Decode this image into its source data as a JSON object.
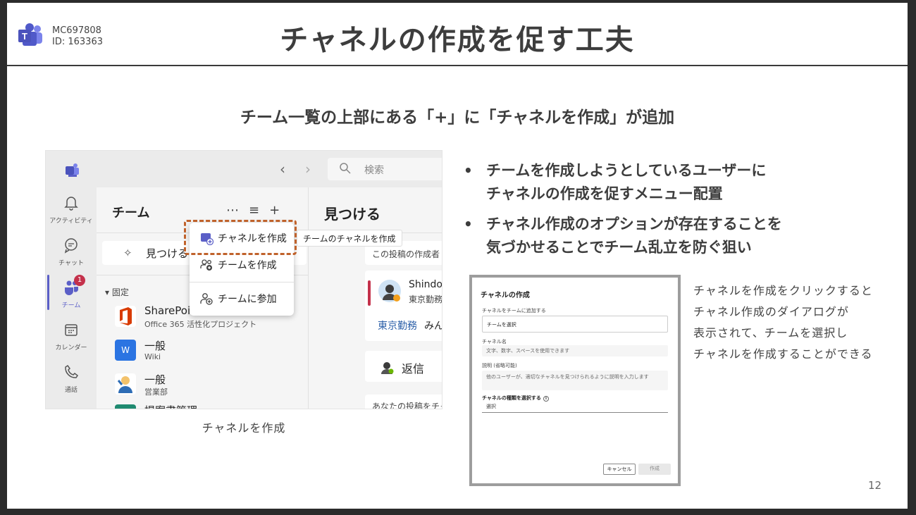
{
  "header": {
    "mc_code": "MC697808",
    "id_label": "ID: 163363",
    "title": "チャネルの作成を促す工夫"
  },
  "subtitle": "チーム一覧の上部にある「+」に「チャネルを作成」が追加",
  "teams_window": {
    "search_placeholder": "検索",
    "nav_back": "‹",
    "nav_forward": "›",
    "rail": [
      {
        "label": "アクティビティ",
        "icon": "bell-icon"
      },
      {
        "label": "チャット",
        "icon": "chat-icon"
      },
      {
        "label": "チーム",
        "icon": "teams-icon",
        "badge": "1"
      },
      {
        "label": "カレンダー",
        "icon": "calendar-icon"
      },
      {
        "label": "通話",
        "icon": "phone-icon"
      }
    ],
    "panel_title": "チーム",
    "panel_icons": {
      "more": "⋯",
      "filter": "≡",
      "add": "+"
    },
    "discover_label": "見つける",
    "pinned_label": "▾ 固定",
    "teams": [
      {
        "name": "SharePoint",
        "sub": "Office 365 活性化プロジェクト",
        "color": "#d83b01"
      },
      {
        "name": "一般",
        "sub": "Wiki",
        "color": "#2b74e2"
      },
      {
        "name": "一般",
        "sub": "営業部",
        "color": "#f3c26b"
      },
      {
        "name": "提案書管理",
        "sub": "",
        "color": "#1f8a70"
      }
    ],
    "main_title": "見つける",
    "card1_text": "この投稿の作成者",
    "card2_name": "Shindo",
    "card2_sub": "東京勤務",
    "card2_link": "東京勤務",
    "card2_link_rest": "みん",
    "reply_label": "返信",
    "card3_text": "あなたの投稿をチャ",
    "menu": [
      {
        "label": "チャネルを作成",
        "icon": "channel-add-icon"
      },
      {
        "label": "チームを作成",
        "icon": "team-add-icon"
      },
      {
        "label": "チームに参加",
        "icon": "join-team-icon"
      }
    ],
    "tooltip": "チームのチャネルを作成"
  },
  "caption": "チャネルを作成",
  "bullets": [
    {
      "lines": [
        "チームを作成しようとしているユーザーに",
        "チャネルの作成を促すメニュー配置"
      ]
    },
    {
      "lines": [
        "チャネル作成のオプションが存在することを",
        "気づかせることでチーム乱立を防ぐ狙い"
      ]
    }
  ],
  "dialog": {
    "title": "チャネルの作成",
    "team_label": "チャネルをチームに追加する",
    "team_value": "チームを選択",
    "name_label": "チャネル名",
    "name_placeholder": "文字、数字、スペースを使用できます",
    "desc_label": "説明 (省略可能)",
    "desc_placeholder": "他のユーザーが、適切なチャネルを見つけられるように説明を入力します",
    "type_label": "チャネルの種類を選択する",
    "type_value": "選択",
    "info_glyph": "i",
    "chevron_glyph": "⌵",
    "cancel_label": "キャンセル",
    "create_label": "作成"
  },
  "dialog_description": [
    "チャネルを作成をクリックすると",
    "チャネル作成のダイアログが",
    "表示されて、チームを選択し",
    "チャネルを作成することができる"
  ],
  "page_number": "12",
  "colors": {
    "teams_purple": "#5b5fc7",
    "highlight_dash": "#c0622b",
    "badge_red": "#c4314b",
    "link_blue": "#2b5fa8"
  }
}
